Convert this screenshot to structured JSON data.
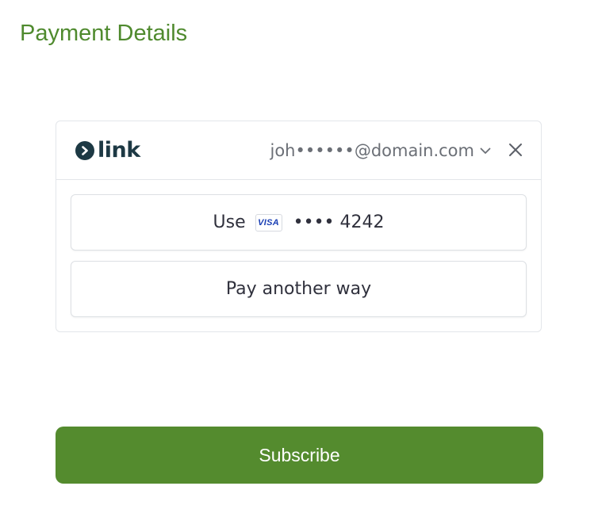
{
  "page": {
    "title": "Payment Details"
  },
  "link": {
    "logo_text": "link",
    "email": "joh••••••@domain.com",
    "use_label": "Use",
    "card_brand": "VISA",
    "card_masked": "•••• 4242",
    "pay_another_label": "Pay another way"
  },
  "actions": {
    "subscribe_label": "Subscribe"
  },
  "colors": {
    "title": "#4f8a2e",
    "subscribe_bg": "#548b2e",
    "link_brand": "#1d3944",
    "visa_blue": "#1a3fb4"
  }
}
